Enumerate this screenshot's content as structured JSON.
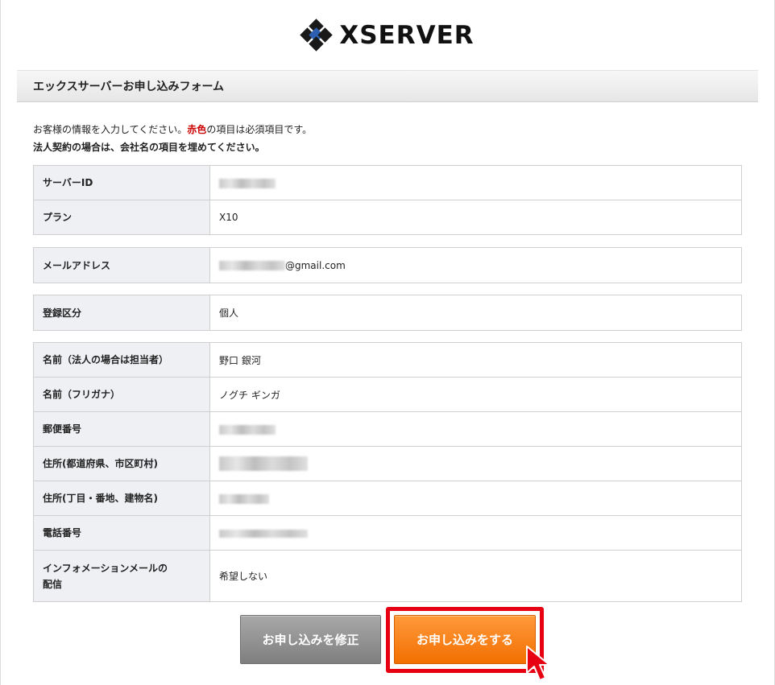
{
  "logo": {
    "text": "XSERVER"
  },
  "form_title": "エックスサーバーお申し込みフォーム",
  "intro": {
    "line1_before": "お客様の情報を入力してください。",
    "line1_required": "赤色",
    "line1_after": "の項目は必須項目です。",
    "line2": "法人契約の場合は、会社名の項目を埋めてください。"
  },
  "account": {
    "server_id_label": "サーバーID",
    "plan_label": "プラン",
    "plan_value": "X10"
  },
  "email": {
    "label": "メールアドレス",
    "domain": "@gmail.com"
  },
  "registration": {
    "label": "登録区分",
    "value": "個人"
  },
  "personal": {
    "name_label": "名前（法人の場合は担当者）",
    "name_value": "野口 銀河",
    "kana_label": "名前（フリガナ）",
    "kana_value": "ノグチ ギンガ",
    "postal_label": "郵便番号",
    "address1_label": "住所(都道府県、市区町村)",
    "address2_label": "住所(丁目・番地、建物名)",
    "phone_label": "電話番号",
    "newsletter_label_1": "インフォメーションメールの",
    "newsletter_label_2": "配信",
    "newsletter_value": "希望しない"
  },
  "buttons": {
    "edit": "お申し込みを修正",
    "apply": "お申し込みをする"
  },
  "colors": {
    "required": "#cc0000",
    "apply_button": "#f47a10",
    "highlight": "#e60012",
    "edit_button": "#8e8e8e",
    "logo_blue": "#2e5fb0"
  }
}
